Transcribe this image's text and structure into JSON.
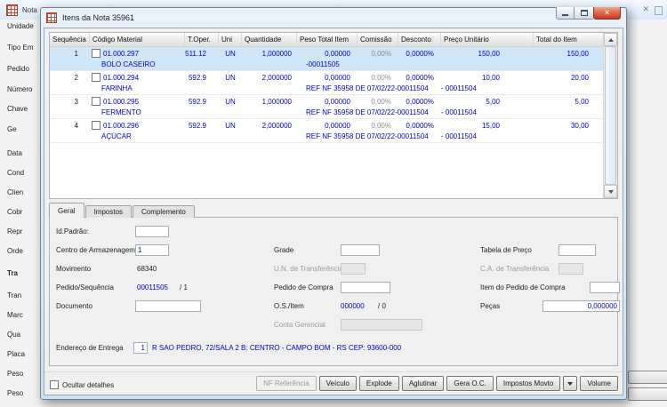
{
  "colors": {
    "data_blue": "#0000cc",
    "selected_row": "#cfe6f9",
    "close_button_red": "#c23c24",
    "titlebar_blue": "#dcebf8"
  },
  "background": {
    "app_title": "Nota",
    "left_labels": [
      "Unidade",
      "Tipo Em",
      "Pedido",
      "Número",
      "Chave",
      "Ge",
      "Data",
      "Cond",
      "Clien",
      "Cobr",
      "Repr",
      "Orde",
      "Tra",
      "Tran",
      "Marc",
      "Qua",
      "Placa",
      "Peso",
      "Peso"
    ]
  },
  "dialog": {
    "title": "Itens da Nota 35961",
    "grid": {
      "columns": [
        "Sequência",
        "Código Material",
        "T.Oper.",
        "Uni",
        "Quantidade",
        "Peso Total Item",
        "Comissão",
        "Desconto",
        "Preço Unitário",
        "Total do Item"
      ],
      "rows": [
        {
          "seq": "1",
          "codigo": "01.000.297",
          "toper": "511.12",
          "uni": "UN",
          "qtd": "1,000000",
          "peso": "0,00000",
          "comissao": "0,00%",
          "desconto": "0,0000%",
          "preco": "150,00",
          "total": "150,00",
          "material": "BOLO CASEIRO",
          "ref1": "-00011505",
          "ref2": ""
        },
        {
          "seq": "2",
          "codigo": "01.000.294",
          "toper": "592.9",
          "uni": "UN",
          "qtd": "2,000000",
          "peso": "0,00000",
          "comissao": "0,00%",
          "desconto": "0,0000%",
          "preco": "10,00",
          "total": "20,00",
          "material": "FARINHA",
          "ref1": "REF NF 35958 DE 07/02/22-00011504",
          "ref2": "- 00011504"
        },
        {
          "seq": "3",
          "codigo": "01.000.295",
          "toper": "592.9",
          "uni": "UN",
          "qtd": "1,000000",
          "peso": "0,00000",
          "comissao": "0,00%",
          "desconto": "0,0000%",
          "preco": "5,00",
          "total": "5,00",
          "material": "FERMENTO",
          "ref1": "REF NF 35958 DE 07/02/22-00011504",
          "ref2": "- 00011504"
        },
        {
          "seq": "4",
          "codigo": "01.000.296",
          "toper": "592.9",
          "uni": "UN",
          "qtd": "2,000000",
          "peso": "0,00000",
          "comissao": "0,00%",
          "desconto": "0,0000%",
          "preco": "15,00",
          "total": "30,00",
          "material": "AÇÚCAR",
          "ref1": "REF NF 35958 DE 07/02/22-00011504",
          "ref2": "- 00011504"
        }
      ]
    },
    "tabs": {
      "geral": "Geral",
      "impostos": "Impostos",
      "complemento": "Complemento"
    },
    "form": {
      "id_padrao": {
        "label": "Id.Padrão:",
        "value": ""
      },
      "centro_armazenagem": {
        "label": "Centro de Armazenagem",
        "value": "1"
      },
      "movimento": {
        "label": "Movimento",
        "value": "68340"
      },
      "pedido_sequencia": {
        "label": "Pedido/Sequência",
        "pedido": "00011505",
        "seq": "/ 1"
      },
      "documento": {
        "label": "Documento",
        "value": ""
      },
      "grade": {
        "label": "Grade",
        "value": ""
      },
      "un_transferencia": {
        "label": "U.N. de Transferência",
        "value": ""
      },
      "pedido_compra": {
        "label": "Pedido de Compra",
        "value": ""
      },
      "os_item": {
        "label": "O.S./Item",
        "os": "000000",
        "item": "/ 0"
      },
      "conta_gerencial": {
        "label": "Conta Gerencial",
        "value": ""
      },
      "tabela_preco": {
        "label": "Tabela de Preço",
        "value": ""
      },
      "ca_transferencia": {
        "label": "C.A. de Transferência",
        "value": ""
      },
      "item_pedido_compra": {
        "label": "Item do Pedido de Compra",
        "value": ""
      },
      "pecas": {
        "label": "Peças",
        "value": "0,000000"
      },
      "endereco_entrega": {
        "label": "Endereço de Entrega",
        "num": "1",
        "value": "R SAO PEDRO, 72/SALA 2 B: CENTRO - CAMPO BOM - RS CEP: 93600-000"
      }
    },
    "footer": {
      "ocultar_detalhes": "Ocultar detalhes",
      "buttons": {
        "nf_referencia": "NF Referência",
        "veiculo": "Veículo",
        "explode": "Explode",
        "aglutinar": "Aglutinar",
        "gera_oc": "Gera O.C.",
        "impostos_movto": "Impostos Movto",
        "volume": "Volume"
      }
    }
  }
}
